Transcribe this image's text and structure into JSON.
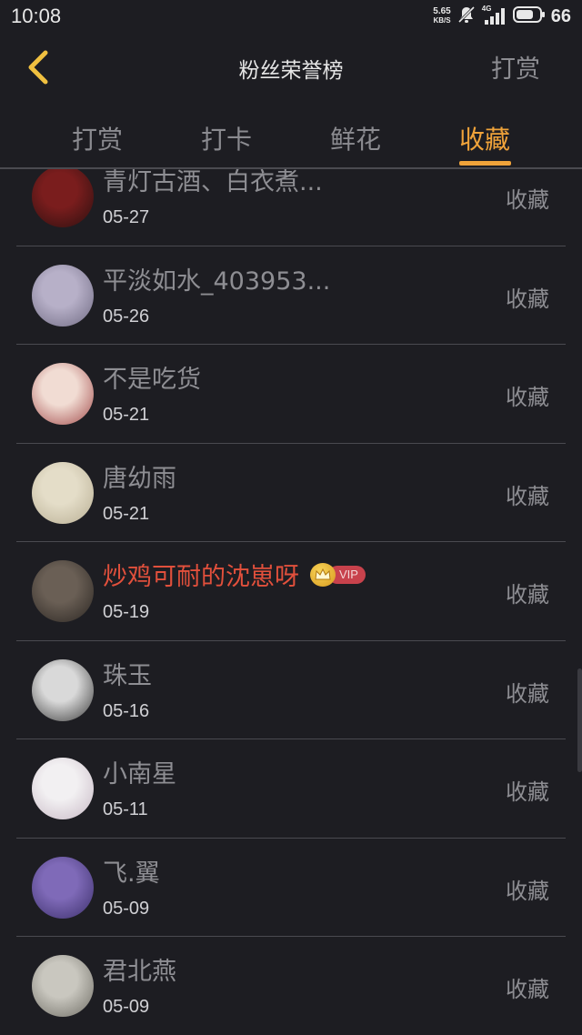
{
  "status_bar": {
    "time": "10:08",
    "net_speed_value": "5.65",
    "net_speed_unit": "KB/S",
    "signal_label": "4G",
    "battery": "66"
  },
  "header": {
    "title": "粉丝荣誉榜",
    "action_label": "打赏"
  },
  "tabs": [
    {
      "label": "打赏",
      "active": false
    },
    {
      "label": "打卡",
      "active": false
    },
    {
      "label": "鲜花",
      "active": false
    },
    {
      "label": "收藏",
      "active": true
    }
  ],
  "fans": [
    {
      "name": "青灯古酒、白衣煮...",
      "date": "05-27",
      "action": "收藏",
      "vip": false,
      "avatar_colors": [
        "#7a1d1d",
        "#2a1010"
      ]
    },
    {
      "name": "平淡如水_403953...",
      "date": "05-26",
      "action": "收藏",
      "vip": false,
      "avatar_colors": [
        "#b7b0c8",
        "#6f6a82"
      ]
    },
    {
      "name": "不是吃货",
      "date": "05-21",
      "action": "收藏",
      "vip": false,
      "avatar_colors": [
        "#f1dcd3",
        "#a24a4a"
      ]
    },
    {
      "name": "唐幼雨",
      "date": "05-21",
      "action": "收藏",
      "vip": false,
      "avatar_colors": [
        "#e4ddc8",
        "#b8ae93"
      ]
    },
    {
      "name": "炒鸡可耐的沈崽呀",
      "date": "05-19",
      "action": "收藏",
      "vip": true,
      "vip_label": "VIP",
      "avatar_colors": [
        "#6a5f55",
        "#2b2622"
      ]
    },
    {
      "name": "珠玉",
      "date": "05-16",
      "action": "收藏",
      "vip": false,
      "avatar_colors": [
        "#d9d9d9",
        "#3a3a3a"
      ]
    },
    {
      "name": "小南星",
      "date": "05-11",
      "action": "收藏",
      "vip": false,
      "avatar_colors": [
        "#f2f0f2",
        "#c7b8c4"
      ]
    },
    {
      "name": "飞.翼",
      "date": "05-09",
      "action": "收藏",
      "vip": false,
      "avatar_colors": [
        "#7f6ab8",
        "#3b2f6a"
      ]
    },
    {
      "name": "君北燕",
      "date": "05-09",
      "action": "收藏",
      "vip": false,
      "avatar_colors": [
        "#c9c7bf",
        "#6e6c64"
      ]
    }
  ],
  "colors": {
    "background": "#1d1d22",
    "accent": "#f0a33a",
    "vip_name": "#e2503c",
    "divider": "#4a4a50"
  }
}
